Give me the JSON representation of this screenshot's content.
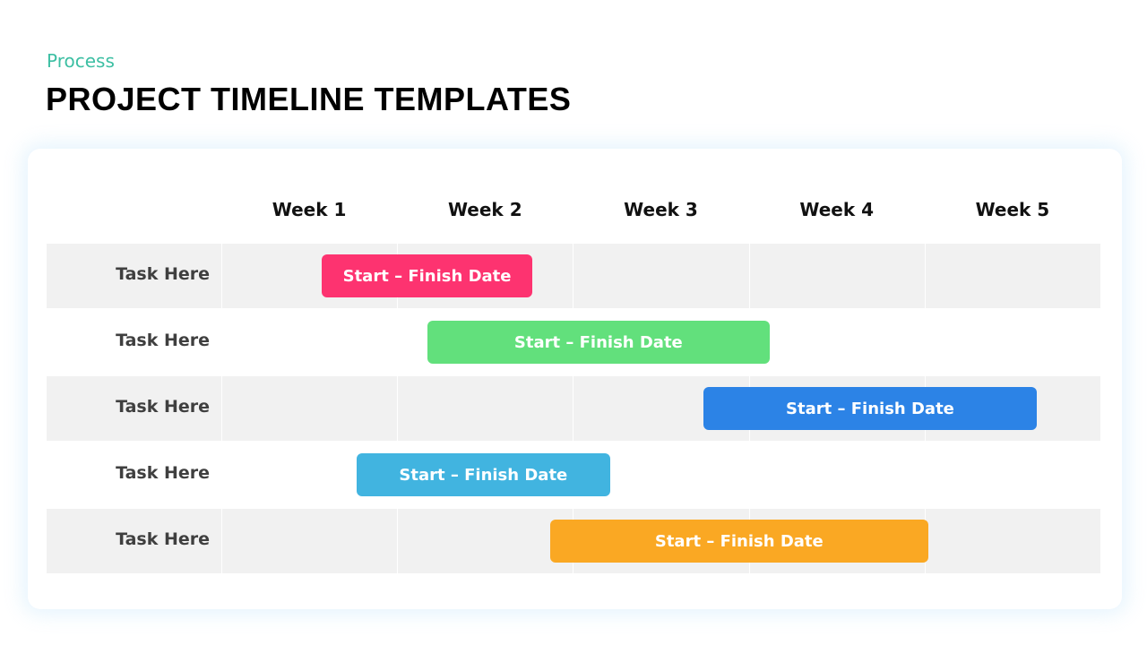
{
  "header": {
    "subtitle": "Process",
    "title": "PROJECT TIMELINE TEMPLATES"
  },
  "colors": {
    "subtitle": "#3dbfa3",
    "row_shade": "#f1f1f1"
  },
  "chart_data": {
    "type": "gantt",
    "title": "PROJECT TIMELINE TEMPLATES",
    "x_unit": "weeks",
    "xlim": [
      0,
      5
    ],
    "categories": [
      "Week 1",
      "Week 2",
      "Week 3",
      "Week 4",
      "Week 5"
    ],
    "tasks": [
      {
        "label": "Task Here",
        "bar_label": "Start – Finish Date",
        "start": 0.57,
        "end": 1.77,
        "color": "#fd3370",
        "shaded": true
      },
      {
        "label": "Task Here",
        "bar_label": "Start – Finish Date",
        "start": 1.17,
        "end": 3.12,
        "color": "#62e07c",
        "shaded": false
      },
      {
        "label": "Task Here",
        "bar_label": "Start – Finish Date",
        "start": 2.74,
        "end": 4.64,
        "color": "#2c83e6",
        "shaded": true
      },
      {
        "label": "Task Here",
        "bar_label": "Start – Finish Date",
        "start": 0.77,
        "end": 2.21,
        "color": "#41b4e0",
        "shaded": false
      },
      {
        "label": "Task Here",
        "bar_label": "Start – Finish Date",
        "start": 1.87,
        "end": 4.02,
        "color": "#faa823",
        "shaded": true
      }
    ]
  }
}
